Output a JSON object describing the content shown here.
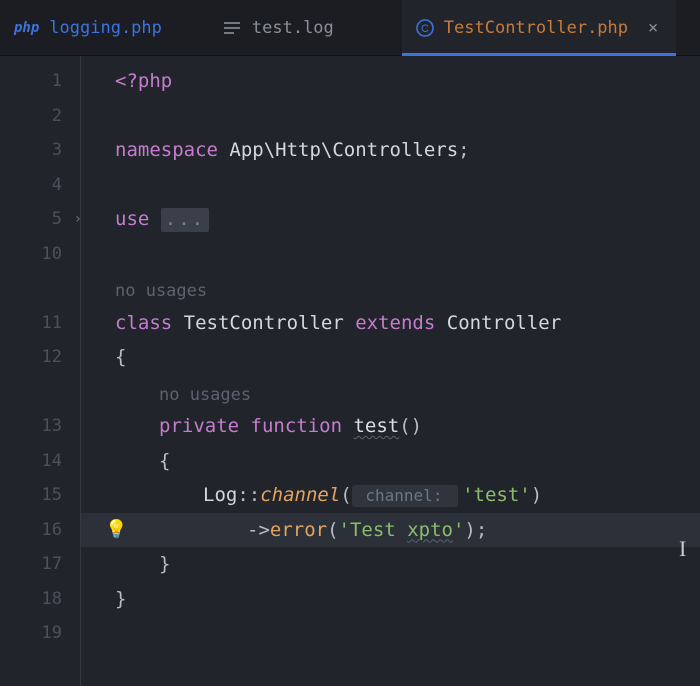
{
  "tabs": [
    {
      "icon_label": "php",
      "label": "logging.php"
    },
    {
      "label": "test.log"
    },
    {
      "label": "TestController.php",
      "close": "×"
    }
  ],
  "gutter": [
    "1",
    "2",
    "3",
    "4",
    "5",
    "10",
    "",
    "11",
    "12",
    "",
    "13",
    "14",
    "15",
    "16",
    "17",
    "18",
    "19"
  ],
  "code": {
    "l1_open": "<?php",
    "l3_ns_kw": "namespace",
    "l3_ns": " App\\Http\\Controllers",
    "l3_semi": ";",
    "l5_use_kw": "use ",
    "l5_fold": "...",
    "hint_nousages": "no usages",
    "l11_class_kw": "class ",
    "l11_name": "TestController",
    "l11_extends": " extends ",
    "l11_parent": "Controller",
    "l12_brace": "{",
    "hint_nousages2": "no usages",
    "l13_priv": "private ",
    "l13_func": "function ",
    "l13_name": "test",
    "l13_paren": "()",
    "l14_brace": "{",
    "l15_log": "Log",
    "l15_dcolon": "::",
    "l15_channel": "channel",
    "l15_open": "(",
    "l15_hint": " channel: ",
    "l15_arg": "'test'",
    "l15_close": ")",
    "l16_arrow": "->",
    "l16_error": "error",
    "l16_open": "(",
    "l16_arg_a": "'Test ",
    "l16_arg_b": "xpto",
    "l16_arg_c": "'",
    "l16_close": ");",
    "l17_brace": "}",
    "l18_brace": "}"
  }
}
